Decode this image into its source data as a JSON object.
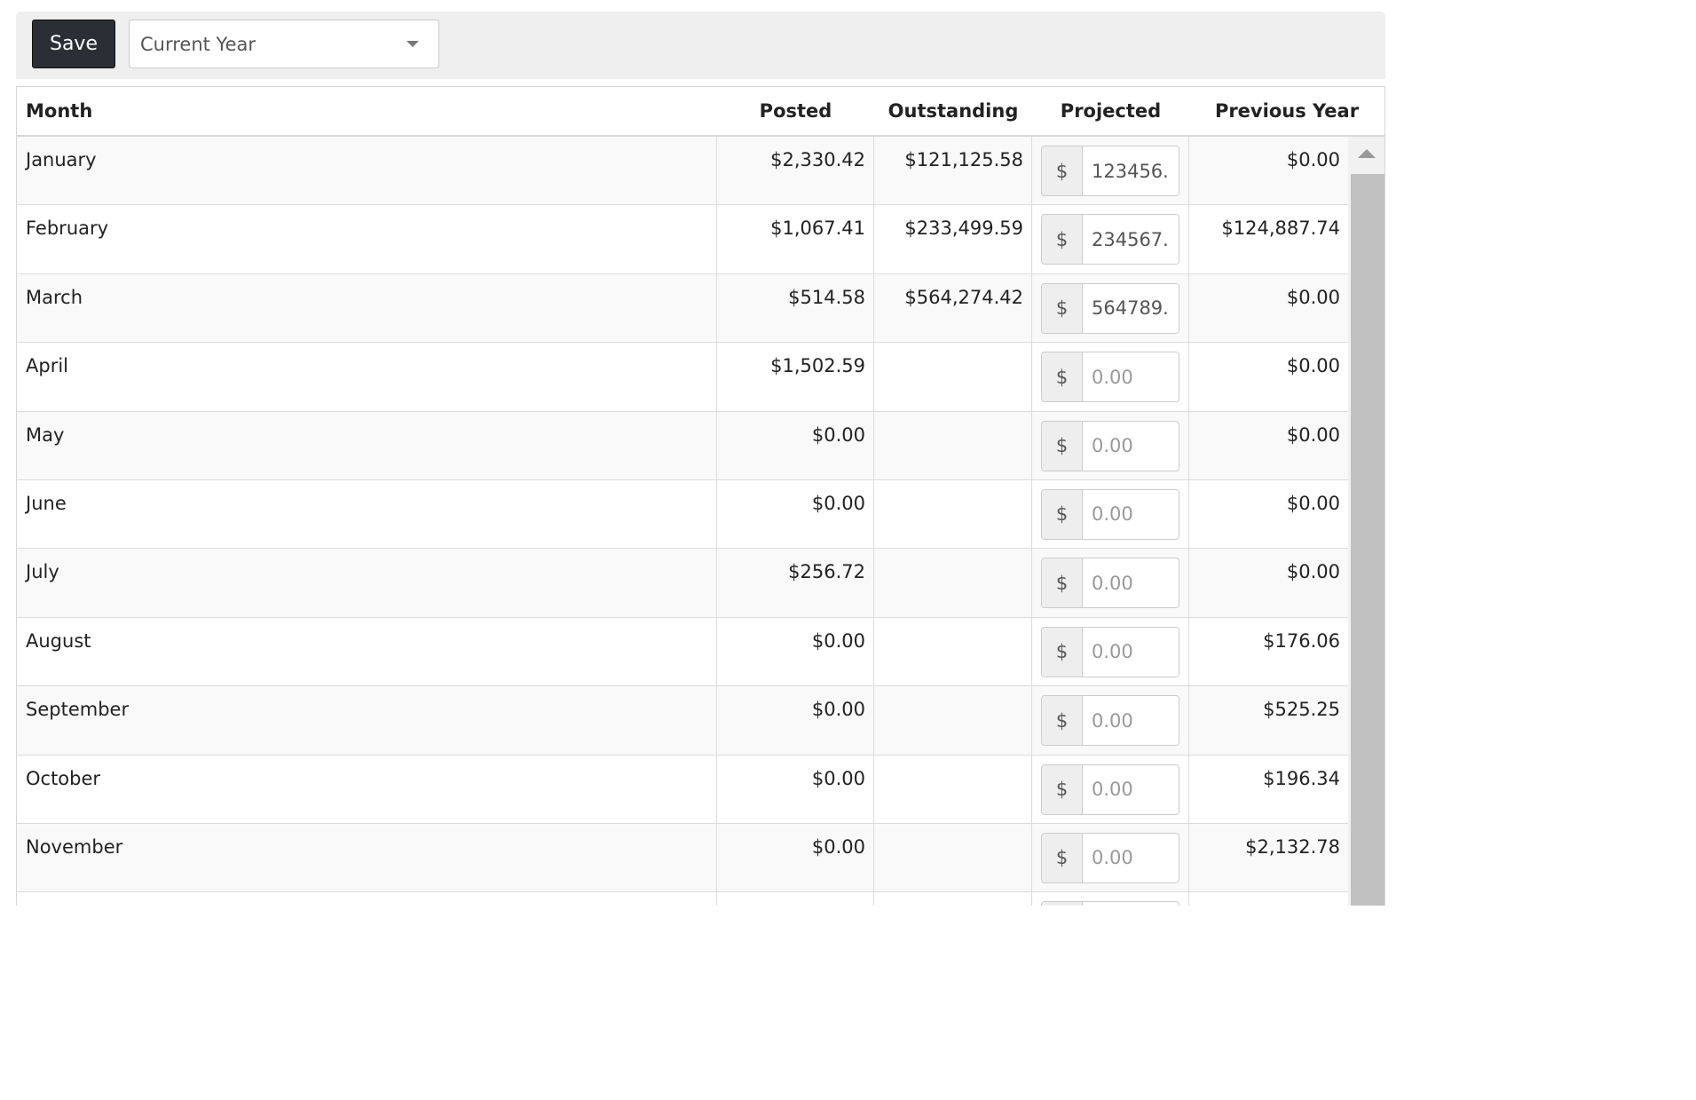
{
  "toolbar": {
    "save_label": "Save",
    "year_select_value": "Current Year"
  },
  "table": {
    "headers": {
      "month": "Month",
      "posted": "Posted",
      "outstanding": "Outstanding",
      "projected": "Projected",
      "previous_year": "Previous Year"
    },
    "currency_symbol": "$",
    "projected_placeholder": "0.00",
    "rows": [
      {
        "month": "January",
        "posted": "$2,330.42",
        "outstanding": "$121,125.58",
        "projected": "123456.",
        "previous_year": "$0.00"
      },
      {
        "month": "February",
        "posted": "$1,067.41",
        "outstanding": "$233,499.59",
        "projected": "234567.",
        "previous_year": "$124,887.74"
      },
      {
        "month": "March",
        "posted": "$514.58",
        "outstanding": "$564,274.42",
        "projected": "564789.",
        "previous_year": "$0.00"
      },
      {
        "month": "April",
        "posted": "$1,502.59",
        "outstanding": "",
        "projected": "",
        "previous_year": "$0.00"
      },
      {
        "month": "May",
        "posted": "$0.00",
        "outstanding": "",
        "projected": "",
        "previous_year": "$0.00"
      },
      {
        "month": "June",
        "posted": "$0.00",
        "outstanding": "",
        "projected": "",
        "previous_year": "$0.00"
      },
      {
        "month": "July",
        "posted": "$256.72",
        "outstanding": "",
        "projected": "",
        "previous_year": "$0.00"
      },
      {
        "month": "August",
        "posted": "$0.00",
        "outstanding": "",
        "projected": "",
        "previous_year": "$176.06"
      },
      {
        "month": "September",
        "posted": "$0.00",
        "outstanding": "",
        "projected": "",
        "previous_year": "$525.25"
      },
      {
        "month": "October",
        "posted": "$0.00",
        "outstanding": "",
        "projected": "",
        "previous_year": "$196.34"
      },
      {
        "month": "November",
        "posted": "$0.00",
        "outstanding": "",
        "projected": "",
        "previous_year": "$2,132.78"
      },
      {
        "month": "",
        "posted": "",
        "outstanding": "",
        "projected": "",
        "previous_year": ""
      }
    ]
  }
}
